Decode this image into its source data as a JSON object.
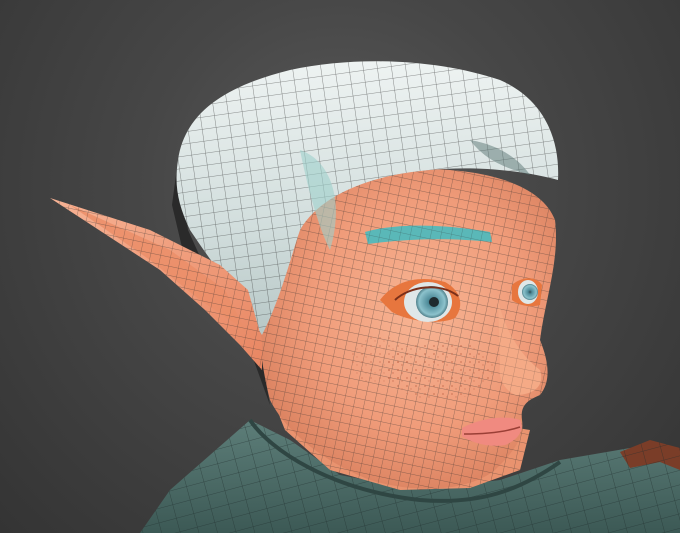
{
  "viewport": {
    "content": "3d-wireframe-render",
    "background_color": "#454545"
  },
  "model": {
    "hair_color": "#d8e3e2",
    "skin_color": "#f0a07e",
    "brow_color": "#5ab8b8",
    "iris_color": "#6aa6b4",
    "ear_color": "#f29b77",
    "shirt_color": "#4a6b66",
    "strap_color": "#7a3d28",
    "wire_color": "#2a2a2a"
  }
}
